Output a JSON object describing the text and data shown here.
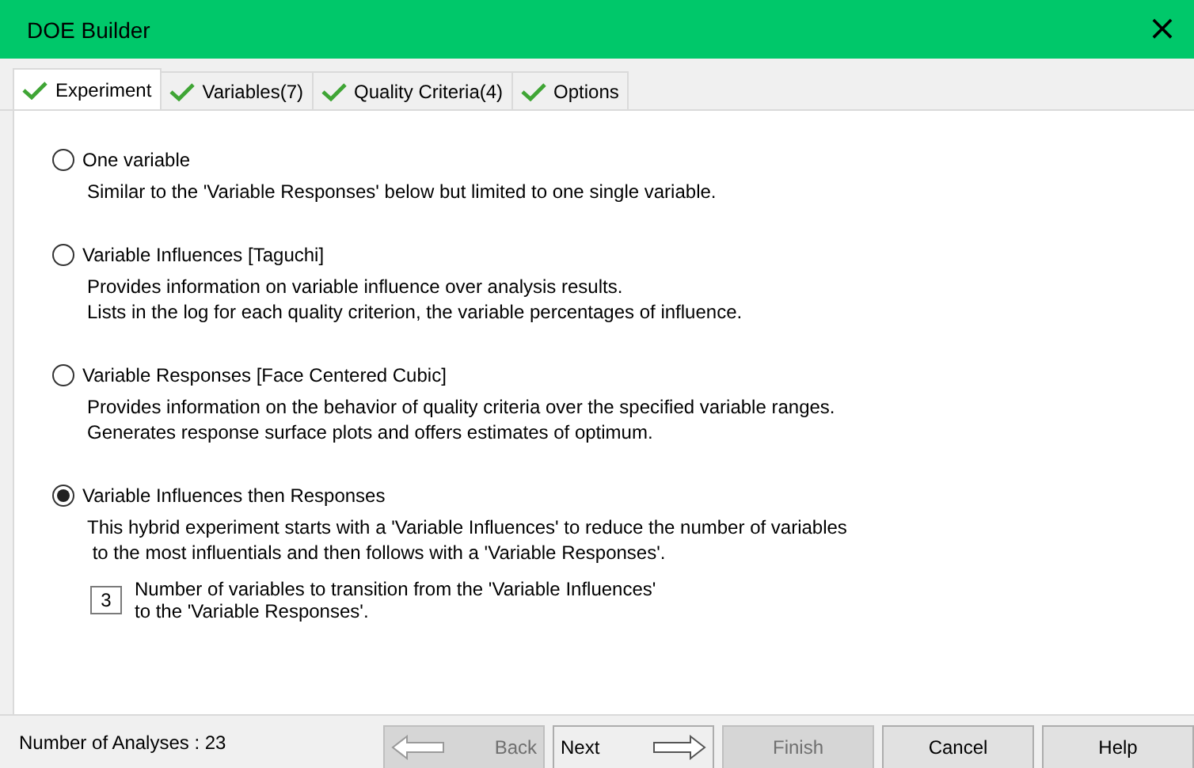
{
  "window": {
    "title": "DOE Builder",
    "close": "×"
  },
  "tabs": [
    {
      "label": "Experiment",
      "selected": true,
      "done": true
    },
    {
      "label": "Variables(7)",
      "selected": false,
      "done": true
    },
    {
      "label": "Quality Criteria(4)",
      "selected": false,
      "done": true
    },
    {
      "label": "Options",
      "selected": false,
      "done": true
    }
  ],
  "options": [
    {
      "label": "One variable",
      "selected": false,
      "lines": [
        "Similar to the 'Variable Responses' below but limited to one single variable."
      ]
    },
    {
      "label": "Variable Influences [Taguchi]",
      "selected": false,
      "lines": [
        "Provides information on variable influence over analysis results.",
        "Lists in the log for each quality criterion, the variable percentages of influence."
      ]
    },
    {
      "label": "Variable Responses [Face Centered Cubic]",
      "selected": false,
      "lines": [
        "Provides information on the behavior of quality criteria over the specified variable ranges.",
        "Generates response surface plots and offers estimates of optimum."
      ]
    },
    {
      "label": "Variable Influences then Responses",
      "selected": true,
      "lines": [
        "This hybrid experiment starts with a 'Variable Influences' to reduce the number of variables",
        " to the most influentials and then follows with a 'Variable Responses'."
      ],
      "transition": {
        "value": "3",
        "lines": [
          "Number of variables to transition from the 'Variable Influences'",
          "to the 'Variable Responses'."
        ]
      }
    }
  ],
  "status": "Number of Analyses : 23",
  "buttons": [
    {
      "label": "Back",
      "kind": "back",
      "disabled": true
    },
    {
      "label": "Next",
      "kind": "next",
      "disabled": false
    },
    {
      "label": "Finish",
      "kind": "plain",
      "disabled": true
    },
    {
      "label": "Cancel",
      "kind": "plain",
      "disabled": false
    },
    {
      "label": "Help",
      "kind": "plain",
      "disabled": false
    }
  ]
}
